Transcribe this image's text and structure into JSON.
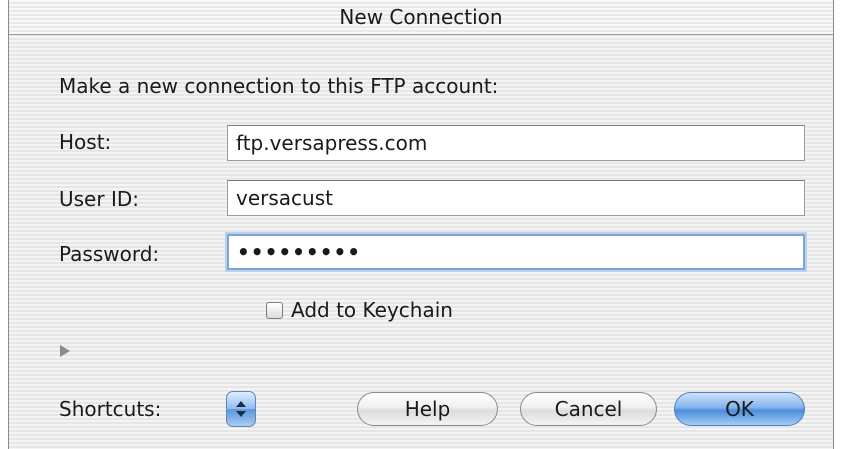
{
  "window": {
    "title": "New Connection"
  },
  "form": {
    "prompt": "Make a new connection to this FTP account:",
    "host_label": "Host:",
    "host_value": "ftp.versapress.com",
    "user_label": "User ID:",
    "user_value": "versacust",
    "password_label": "Password:",
    "password_value": "•••••••••",
    "keychain_label": "Add to Keychain",
    "keychain_checked": false
  },
  "footer": {
    "shortcuts_label": "Shortcuts:",
    "help_label": "Help",
    "cancel_label": "Cancel",
    "ok_label": "OK"
  },
  "icons": {
    "disclosure": "disclosure-triangle-icon",
    "popup": "popup-arrows-icon"
  },
  "colors": {
    "default_button": "#4a8ddd",
    "focus_ring": "#7da6d8"
  }
}
